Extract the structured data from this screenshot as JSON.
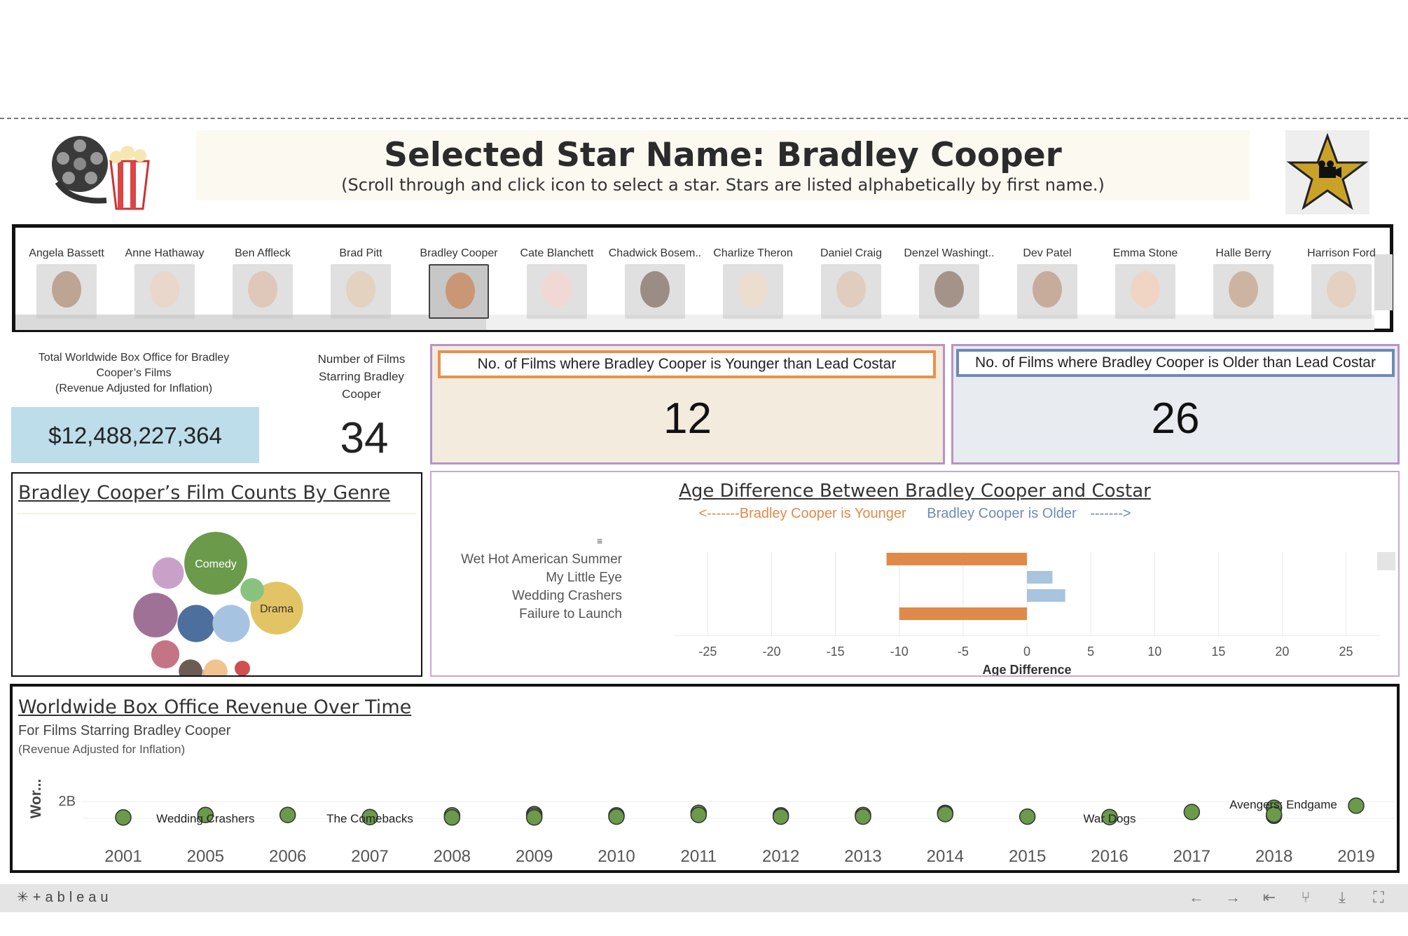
{
  "header": {
    "title": "Selected Star Name: Bradley Cooper",
    "subtitle": "(Scroll through and click icon to select a star. Stars are listed alphabetically by first name.)",
    "reel_icon": "film-reel-popcorn-icon",
    "star_icon": "gold-star-camera-icon"
  },
  "stars": [
    {
      "name": "Angela Bassett",
      "selected": false,
      "skin": "#8a5a3c"
    },
    {
      "name": "Anne Hathaway",
      "selected": false,
      "skin": "#d9b8a2"
    },
    {
      "name": "Ben Affleck",
      "selected": false,
      "skin": "#c69c80"
    },
    {
      "name": "Brad Pitt",
      "selected": false,
      "skin": "#cfae8e"
    },
    {
      "name": "Bradley Cooper",
      "selected": true,
      "skin": "#c99775"
    },
    {
      "name": "Cate Blanchett",
      "selected": false,
      "skin": "#e6b9b1"
    },
    {
      "name": "Chadwick Bosem..",
      "selected": false,
      "skin": "#4a3125"
    },
    {
      "name": "Charlize Theron",
      "selected": false,
      "skin": "#ddc3a7"
    },
    {
      "name": "Daniel Craig",
      "selected": false,
      "skin": "#c9a58e"
    },
    {
      "name": "Denzel Washingt..",
      "selected": false,
      "skin": "#5b3b2a"
    },
    {
      "name": "Dev Patel",
      "selected": false,
      "skin": "#9b6a4a"
    },
    {
      "name": "Emma Stone",
      "selected": false,
      "skin": "#e6b395"
    },
    {
      "name": "Halle Berry",
      "selected": false,
      "skin": "#a57656"
    },
    {
      "name": "Harrison Ford",
      "selected": false,
      "skin": "#cfad92"
    }
  ],
  "kpis": {
    "revenue_label_1": "Total Worldwide Box Office for Bradley",
    "revenue_label_2": "Cooper’s Films",
    "revenue_label_3": "(Revenue Adjusted for Inflation)",
    "revenue_value": "$12,488,227,364",
    "count_label_1": "Number of Films",
    "count_label_2": "Starring Bradley",
    "count_label_3": "Cooper",
    "count_value": "34",
    "younger_title": "No. of Films where Bradley Cooper is Younger than Lead Costar",
    "younger_value": "12",
    "older_title": "No. of Films where Bradley Cooper is Older than Lead Costar",
    "older_value": "26"
  },
  "genre": {
    "title": "Bradley Cooper’s Film Counts By Genre",
    "bubbles": [
      {
        "label": "Comedy",
        "value": 10,
        "color": "#6a9a4a"
      },
      {
        "label": "Drama",
        "value": 7,
        "color": "#e3c464"
      },
      {
        "label": "",
        "value": 5,
        "color": "#a07197"
      },
      {
        "label": "",
        "value": 3.5,
        "color": "#4d6f9e"
      },
      {
        "label": "",
        "value": 3.5,
        "color": "#a6c3e2"
      },
      {
        "label": "",
        "value": 2.5,
        "color": "#c9a1c8"
      },
      {
        "label": "",
        "value": 2,
        "color": "#c57486"
      },
      {
        "label": "",
        "value": 1.4,
        "color": "#89c27e"
      },
      {
        "label": "",
        "value": 4,
        "color": "#d7b6a6"
      },
      {
        "label": "",
        "value": 1.4,
        "color": "#6b5c54"
      },
      {
        "label": "",
        "value": 1.4,
        "color": "#f0c38f"
      },
      {
        "label": "",
        "value": 1.2,
        "color": "#eeaaaa"
      },
      {
        "label": "",
        "value": 0.6,
        "color": "#d14f4f"
      },
      {
        "label": "",
        "value": 0.5,
        "color": "#5b4b46"
      }
    ]
  },
  "age_diff": {
    "title": "Age Difference Between Bradley Cooper and Costar",
    "younger_label": "<-------Bradley Cooper is Younger",
    "older_label": "Bradley Cooper is Older",
    "older_arrow": "------->",
    "sort_icon": "sort-icon",
    "colors": {
      "younger": "#e08a4a",
      "older": "#a9c4de"
    },
    "chart_data": {
      "type": "bar",
      "orientation": "horizontal",
      "categories": [
        "Wet Hot American Summer",
        "My Little Eye",
        "Wedding Crashers",
        "Failure to Launch"
      ],
      "values": [
        -11,
        2,
        3,
        -10
      ],
      "xlabel": "Age Difference",
      "xlim": [
        -27,
        27
      ],
      "xticks": [
        "-25",
        "-20",
        "-15",
        "-10",
        "-5",
        "0",
        "5",
        "10",
        "15",
        "20",
        "25"
      ]
    }
  },
  "revenue": {
    "title": "Worldwide Box Office Revenue Over Time",
    "subtitle": "For Films Starring Bradley Cooper",
    "note": "(Revenue Adjusted for Inflation)",
    "chart_data": {
      "type": "scatter",
      "ylabel": "Wor...",
      "yticks": [
        "2B"
      ],
      "xticks": [
        "2001",
        "2005",
        "2006",
        "2007",
        "2008",
        "2009",
        "2010",
        "2011",
        "2012",
        "2013",
        "2014",
        "2015",
        "2016",
        "2017",
        "2018",
        "2019"
      ],
      "color": "#6a9a4a",
      "points": [
        {
          "year": "2001",
          "value": 0.1
        },
        {
          "year": "2005",
          "value": 0.4
        },
        {
          "year": "2006",
          "value": 0.4
        },
        {
          "year": "2007",
          "value": 0.15
        },
        {
          "year": "2008",
          "value": 0.35
        },
        {
          "year": "2008",
          "value": 0.1
        },
        {
          "year": "2009",
          "value": 0.5
        },
        {
          "year": "2009",
          "value": 0.3
        },
        {
          "year": "2009",
          "value": 0.1
        },
        {
          "year": "2010",
          "value": 0.35
        },
        {
          "year": "2010",
          "value": 0.2
        },
        {
          "year": "2011",
          "value": 0.65
        },
        {
          "year": "2011",
          "value": 0.4
        },
        {
          "year": "2012",
          "value": 0.35
        },
        {
          "year": "2012",
          "value": 0.2
        },
        {
          "year": "2013",
          "value": 0.4
        },
        {
          "year": "2013",
          "value": 0.2
        },
        {
          "year": "2014",
          "value": 0.65
        },
        {
          "year": "2014",
          "value": 0.5
        },
        {
          "year": "2015",
          "value": 0.2
        },
        {
          "year": "2016",
          "value": 0.15
        },
        {
          "year": "2017",
          "value": 0.75
        },
        {
          "year": "2018",
          "value": 1.25
        },
        {
          "year": "2018",
          "value": 0.3
        },
        {
          "year": "2018",
          "value": 0.45
        },
        {
          "year": "2019",
          "value": 1.5
        }
      ],
      "annotations": [
        {
          "text": "Wedding Crashers",
          "year": "2005"
        },
        {
          "text": "The Comebacks",
          "year": "2007"
        },
        {
          "text": "War Dogs",
          "year": "2016"
        },
        {
          "text": "Avengers: Endgame",
          "year": "2019"
        }
      ]
    }
  },
  "footer": {
    "logo": "+ableau",
    "logo_icon": "tableau-logo-icon",
    "buttons": [
      "undo-icon",
      "redo-icon",
      "revert-icon",
      "share-icon",
      "download-icon",
      "fullscreen-icon"
    ],
    "button_glyphs": [
      "←",
      "→",
      "⇤",
      "⑂",
      "⤓",
      "⛶"
    ]
  }
}
